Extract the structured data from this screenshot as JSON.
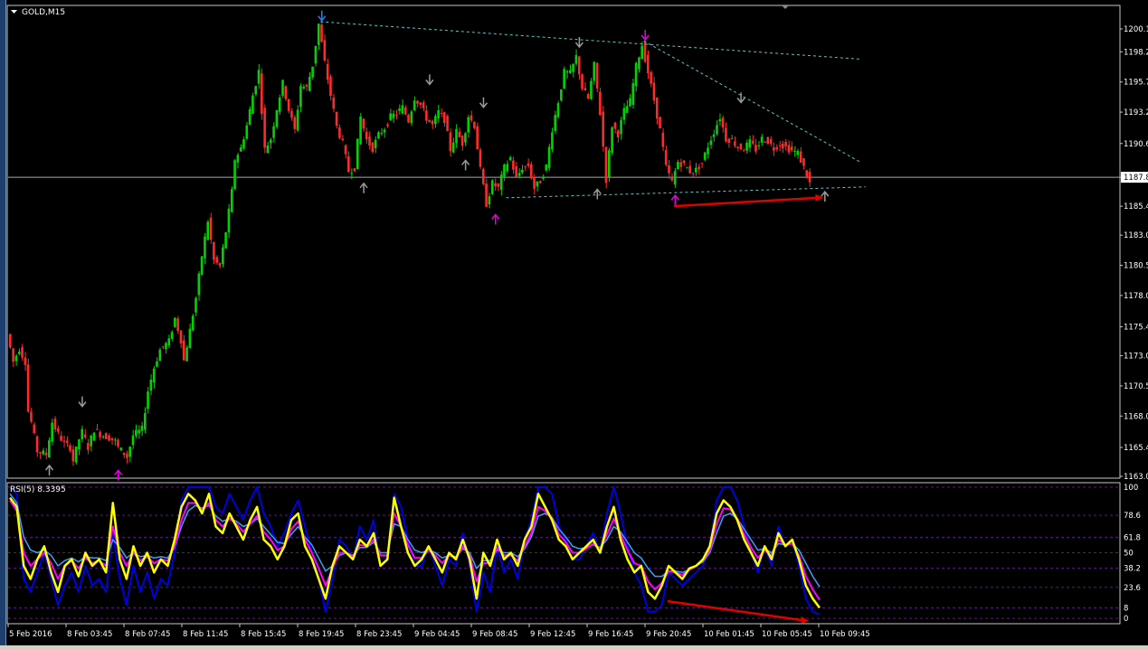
{
  "window": {
    "title": "GOLD,M15",
    "price_marker": "1187.8",
    "colors": {
      "bull": "#00d400",
      "bear": "#ff2a2a",
      "grid_dash": "#7a00b4",
      "trend": "#58c7c7",
      "arrow_red": "#e00000"
    }
  },
  "chart_data": [
    {
      "type": "candlestick",
      "title": "GOLD,M15",
      "symbol": "GOLD",
      "timeframe": "M15",
      "y_ticks": [
        "1200.1",
        "1198.2",
        "1195.7",
        "1193.2",
        "1190.6",
        "1187.8",
        "1185.4",
        "1183.0",
        "1180.5",
        "1178.0",
        "1175.4",
        "1173.0",
        "1170.5",
        "1168.0",
        "1165.4",
        "1163.0"
      ],
      "ylim": [
        1162.8,
        1201.4
      ],
      "current_price": 1187.8,
      "price_path": [
        [
          0,
          1174.8
        ],
        [
          2,
          1172.5
        ],
        [
          4,
          1173.6
        ],
        [
          6,
          1172.5
        ],
        [
          7,
          1168.4
        ],
        [
          8,
          1167.5
        ],
        [
          10,
          1165.1
        ],
        [
          13,
          1164.8
        ],
        [
          15,
          1167.5
        ],
        [
          17,
          1166.5
        ],
        [
          19,
          1165.7
        ],
        [
          21,
          1165.4
        ],
        [
          22,
          1164.3
        ],
        [
          24,
          1166.1
        ],
        [
          25,
          1166.7
        ],
        [
          27,
          1165.4
        ],
        [
          29,
          1166.9
        ],
        [
          31,
          1166.5
        ],
        [
          34,
          1166.2
        ],
        [
          36,
          1165.9
        ],
        [
          37,
          1165.4
        ],
        [
          39,
          1164.9
        ],
        [
          40,
          1164.6
        ],
        [
          42,
          1166.4
        ],
        [
          45,
          1166.9
        ],
        [
          47,
          1170.1
        ],
        [
          49,
          1172.0
        ],
        [
          51,
          1173.5
        ],
        [
          54,
          1174.2
        ],
        [
          56,
          1176.1
        ],
        [
          58,
          1174.3
        ],
        [
          59,
          1172.6
        ],
        [
          61,
          1175.1
        ],
        [
          63,
          1177.8
        ],
        [
          65,
          1181.3
        ],
        [
          67,
          1184.2
        ],
        [
          69,
          1180.9
        ],
        [
          71,
          1180.4
        ],
        [
          73,
          1183.3
        ],
        [
          75,
          1186.6
        ],
        [
          76,
          1189.3
        ],
        [
          78,
          1190.2
        ],
        [
          80,
          1192.1
        ],
        [
          82,
          1194.6
        ],
        [
          84,
          1196.6
        ],
        [
          86,
          1190.1
        ],
        [
          88,
          1191.0
        ],
        [
          90,
          1193.5
        ],
        [
          92,
          1195.6
        ],
        [
          94,
          1193.4
        ],
        [
          96,
          1191.7
        ],
        [
          98,
          1195.4
        ],
        [
          100,
          1195.2
        ],
        [
          102,
          1197.1
        ],
        [
          104,
          1200.5
        ],
        [
          106,
          1197.3
        ],
        [
          108,
          1194.6
        ],
        [
          110,
          1192.0
        ],
        [
          112,
          1190.6
        ],
        [
          114,
          1188.3
        ],
        [
          116,
          1188.6
        ],
        [
          118,
          1192.8
        ],
        [
          120,
          1190.9
        ],
        [
          122,
          1190.2
        ],
        [
          124,
          1191.3
        ],
        [
          126,
          1191.9
        ],
        [
          128,
          1192.8
        ],
        [
          130,
          1193.1
        ],
        [
          132,
          1193.6
        ],
        [
          134,
          1192.5
        ],
        [
          136,
          1194.4
        ],
        [
          138,
          1193.8
        ],
        [
          140,
          1192.7
        ],
        [
          142,
          1192.1
        ],
        [
          144,
          1193.2
        ],
        [
          146,
          1192.6
        ],
        [
          148,
          1190.1
        ],
        [
          150,
          1191.6
        ],
        [
          152,
          1190.6
        ],
        [
          154,
          1192.9
        ],
        [
          156,
          1192.1
        ],
        [
          158,
          1188.4
        ],
        [
          160,
          1185.6
        ],
        [
          162,
          1187.3
        ],
        [
          164,
          1186.9
        ],
        [
          166,
          1188.6
        ],
        [
          168,
          1189.4
        ],
        [
          170,
          1187.7
        ],
        [
          172,
          1188.6
        ],
        [
          174,
          1188.8
        ],
        [
          176,
          1186.9
        ],
        [
          178,
          1187.5
        ],
        [
          180,
          1188.7
        ],
        [
          182,
          1191.8
        ],
        [
          184,
          1194.1
        ],
        [
          186,
          1196.5
        ],
        [
          188,
          1196.4
        ],
        [
          190,
          1197.8
        ],
        [
          192,
          1195.2
        ],
        [
          194,
          1194.3
        ],
        [
          196,
          1197.1
        ],
        [
          198,
          1193.1
        ],
        [
          200,
          1187.6
        ],
        [
          202,
          1192.1
        ],
        [
          204,
          1191.4
        ],
        [
          206,
          1193.3
        ],
        [
          208,
          1194.1
        ],
        [
          210,
          1197.0
        ],
        [
          212,
          1198.8
        ],
        [
          214,
          1196.5
        ],
        [
          216,
          1194.2
        ],
        [
          218,
          1191.7
        ],
        [
          220,
          1188.6
        ],
        [
          222,
          1187.4
        ],
        [
          224,
          1189.1
        ],
        [
          226,
          1188.8
        ],
        [
          228,
          1188.3
        ],
        [
          230,
          1188.4
        ],
        [
          232,
          1189.0
        ],
        [
          234,
          1190.4
        ],
        [
          236,
          1191.6
        ],
        [
          238,
          1192.8
        ],
        [
          240,
          1191.0
        ],
        [
          242,
          1190.9
        ],
        [
          244,
          1190.3
        ],
        [
          246,
          1190.2
        ],
        [
          248,
          1190.7
        ],
        [
          250,
          1190.1
        ],
        [
          252,
          1191.0
        ],
        [
          254,
          1190.8
        ],
        [
          256,
          1190.2
        ],
        [
          258,
          1190.6
        ],
        [
          260,
          1190.3
        ],
        [
          262,
          1190.0
        ],
        [
          264,
          1189.8
        ],
        [
          266,
          1188.6
        ],
        [
          268,
          1187.3
        ]
      ],
      "markers": [
        {
          "x": 13,
          "price": 1163.9,
          "kind": "up",
          "color": "#9a9a9a"
        },
        {
          "x": 24,
          "price": 1168.8,
          "kind": "down",
          "color": "#9a9a9a"
        },
        {
          "x": 36,
          "price": 1163.5,
          "kind": "up",
          "color": "#e000e0"
        },
        {
          "x": 104,
          "price": 1200.8,
          "kind": "down",
          "color": "#1f7fff"
        },
        {
          "x": 118,
          "price": 1187.3,
          "kind": "up",
          "color": "#9a9a9a"
        },
        {
          "x": 140,
          "price": 1195.5,
          "kind": "down",
          "color": "#9a9a9a"
        },
        {
          "x": 152,
          "price": 1189.2,
          "kind": "up",
          "color": "#9a9a9a"
        },
        {
          "x": 158,
          "price": 1193.6,
          "kind": "down",
          "color": "#9a9a9a"
        },
        {
          "x": 162,
          "price": 1184.7,
          "kind": "up",
          "color": "#e000e0"
        },
        {
          "x": 190,
          "price": 1198.6,
          "kind": "down",
          "color": "#9a9a9a"
        },
        {
          "x": 196,
          "price": 1186.8,
          "kind": "up",
          "color": "#9a9a9a"
        },
        {
          "x": 212,
          "price": 1199.2,
          "kind": "down",
          "color": "#e000e0"
        },
        {
          "x": 222,
          "price": 1186.3,
          "kind": "up",
          "color": "#e000e0"
        },
        {
          "x": 244,
          "price": 1194.0,
          "kind": "down",
          "color": "#9a9a9a"
        },
        {
          "x": 272,
          "price": 1186.6,
          "kind": "up",
          "color": "#9a9a9a"
        }
      ],
      "trendlines": [
        {
          "x1": 104,
          "y1": 1200.7,
          "x2": 284,
          "y2": 1197.6,
          "color": "#58c7c7"
        },
        {
          "x1": 212,
          "y1": 1199.1,
          "x2": 284,
          "y2": 1189.1,
          "color": "#58c7c7"
        },
        {
          "x1": 166,
          "y1": 1186.1,
          "x2": 286,
          "y2": 1187.0,
          "color": "#58c7c7"
        }
      ],
      "arrow": {
        "x1": 222,
        "y1": 1185.4,
        "x2": 272,
        "y2": 1186.1,
        "color": "#e00000"
      }
    },
    {
      "type": "line",
      "title": "RSI(5) 8.3395",
      "ylim": [
        0,
        100
      ],
      "levels": [
        "100",
        "78.6",
        "61.8",
        "50",
        "38.2",
        "23.6",
        "8",
        "0"
      ],
      "series": [
        {
          "color": "#ffff00",
          "width": 2.5,
          "values": [
            92,
            85,
            40,
            30,
            45,
            55,
            35,
            20,
            40,
            45,
            32,
            50,
            40,
            45,
            35,
            88,
            45,
            30,
            55,
            40,
            50,
            35,
            45,
            40,
            60,
            85,
            95,
            90,
            80,
            95,
            70,
            65,
            80,
            70,
            60,
            75,
            85,
            60,
            55,
            45,
            55,
            75,
            80,
            55,
            45,
            30,
            15,
            40,
            55,
            50,
            45,
            60,
            55,
            65,
            40,
            45,
            92,
            70,
            50,
            40,
            45,
            55,
            45,
            35,
            50,
            45,
            60,
            45,
            15,
            50,
            40,
            60,
            45,
            50,
            40,
            60,
            70,
            95,
            85,
            75,
            60,
            55,
            45,
            50,
            55,
            60,
            50,
            70,
            85,
            60,
            45,
            35,
            40,
            20,
            15,
            25,
            40,
            35,
            30,
            38,
            40,
            45,
            55,
            80,
            90,
            85,
            75,
            60,
            50,
            40,
            55,
            45,
            65,
            55,
            60,
            45,
            25,
            15,
            8
          ]
        },
        {
          "color": "#ff00ff",
          "width": 2,
          "values": [
            90,
            82,
            50,
            40,
            45,
            50,
            42,
            30,
            40,
            44,
            38,
            46,
            42,
            44,
            40,
            70,
            50,
            40,
            50,
            44,
            47,
            42,
            45,
            44,
            55,
            75,
            88,
            88,
            82,
            88,
            75,
            70,
            76,
            72,
            66,
            72,
            78,
            66,
            60,
            52,
            55,
            68,
            74,
            60,
            50,
            38,
            25,
            38,
            50,
            50,
            47,
            56,
            55,
            60,
            48,
            48,
            80,
            70,
            56,
            46,
            46,
            52,
            48,
            42,
            48,
            46,
            55,
            48,
            28,
            42,
            42,
            54,
            48,
            48,
            44,
            55,
            65,
            85,
            82,
            76,
            64,
            58,
            50,
            50,
            53,
            57,
            52,
            64,
            76,
            64,
            52,
            42,
            40,
            28,
            22,
            27,
            36,
            35,
            33,
            37,
            40,
            44,
            52,
            72,
            84,
            83,
            76,
            64,
            54,
            46,
            52,
            48,
            60,
            56,
            57,
            48,
            32,
            22,
            14
          ]
        },
        {
          "color": "#3aa0ff",
          "width": 1.5,
          "values": [
            95,
            88,
            62,
            52,
            50,
            52,
            48,
            40,
            44,
            46,
            43,
            47,
            46,
            46,
            44,
            60,
            54,
            46,
            50,
            47,
            48,
            46,
            47,
            46,
            54,
            70,
            82,
            86,
            84,
            86,
            78,
            74,
            76,
            74,
            70,
            72,
            76,
            70,
            64,
            58,
            57,
            64,
            70,
            62,
            56,
            46,
            36,
            40,
            48,
            50,
            48,
            54,
            54,
            58,
            50,
            50,
            72,
            70,
            60,
            52,
            50,
            52,
            50,
            46,
            48,
            47,
            53,
            50,
            38,
            44,
            44,
            52,
            50,
            50,
            47,
            53,
            62,
            78,
            80,
            77,
            68,
            62,
            55,
            53,
            54,
            56,
            54,
            60,
            70,
            66,
            58,
            50,
            46,
            38,
            32,
            32,
            36,
            36,
            35,
            37,
            40,
            43,
            50,
            65,
            78,
            80,
            76,
            68,
            60,
            52,
            53,
            50,
            57,
            56,
            57,
            52,
            42,
            32,
            24
          ]
        },
        {
          "color": "#0000e0",
          "width": 2,
          "values": [
            100,
            95,
            30,
            20,
            35,
            50,
            30,
            10,
            25,
            35,
            20,
            40,
            25,
            30,
            20,
            65,
            30,
            10,
            40,
            20,
            35,
            15,
            30,
            25,
            50,
            90,
            100,
            100,
            100,
            100,
            85,
            80,
            95,
            85,
            75,
            90,
            100,
            80,
            70,
            55,
            65,
            80,
            90,
            70,
            50,
            30,
            5,
            30,
            60,
            55,
            45,
            70,
            60,
            75,
            40,
            45,
            95,
            85,
            60,
            40,
            40,
            55,
            40,
            25,
            45,
            40,
            65,
            40,
            5,
            35,
            20,
            55,
            35,
            45,
            30,
            60,
            75,
            100,
            100,
            95,
            70,
            60,
            45,
            45,
            55,
            65,
            50,
            80,
            100,
            80,
            55,
            35,
            25,
            5,
            5,
            10,
            35,
            30,
            25,
            30,
            35,
            40,
            55,
            90,
            100,
            100,
            90,
            70,
            50,
            35,
            55,
            40,
            70,
            55,
            60,
            40,
            15,
            5,
            3
          ]
        }
      ],
      "arrow": {
        "x1": 0.813,
        "y1": 13,
        "x2": 0.987,
        "y2": -2,
        "color": "#e00000"
      }
    }
  ],
  "x_axis": {
    "labels": [
      "5 Feb 2016",
      "8 Feb 03:45",
      "8 Feb 07:45",
      "8 Feb 11:45",
      "8 Feb 15:45",
      "8 Feb 19:45",
      "8 Feb 23:45",
      "9 Feb 04:45",
      "9 Feb 08:45",
      "9 Feb 12:45",
      "9 Feb 16:45",
      "9 Feb 20:45",
      "10 Feb 01:45",
      "10 Feb 05:45",
      "10 Feb 09:45"
    ]
  }
}
